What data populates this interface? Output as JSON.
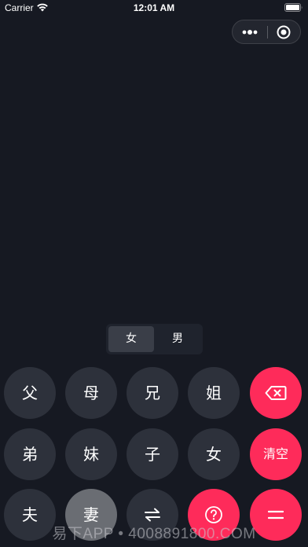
{
  "status_bar": {
    "carrier": "Carrier",
    "time": "12:01 AM"
  },
  "capsule": {
    "more_icon": "more-dots-icon",
    "close_icon": "target-circle-icon"
  },
  "gender_toggle": {
    "options": [
      "女",
      "男"
    ],
    "selected": "女"
  },
  "keypad": {
    "row1": [
      "父",
      "母",
      "兄",
      "姐"
    ],
    "row2": [
      "弟",
      "妹",
      "子",
      "女",
      "清空"
    ],
    "row3": [
      "夫",
      "妻"
    ],
    "backspace_icon": "backspace-icon",
    "swap_icon": "swap-arrows-icon",
    "help_icon": "question-circle-icon",
    "equals_icon": "equals-icon",
    "pressed_key": "妻"
  },
  "watermark": {
    "text": "易下APP • 4008891800.COM"
  },
  "colors": {
    "background": "#161922",
    "key": "#2d313b",
    "accent": "#fe2b5a",
    "pressed": "#6a6d73"
  }
}
